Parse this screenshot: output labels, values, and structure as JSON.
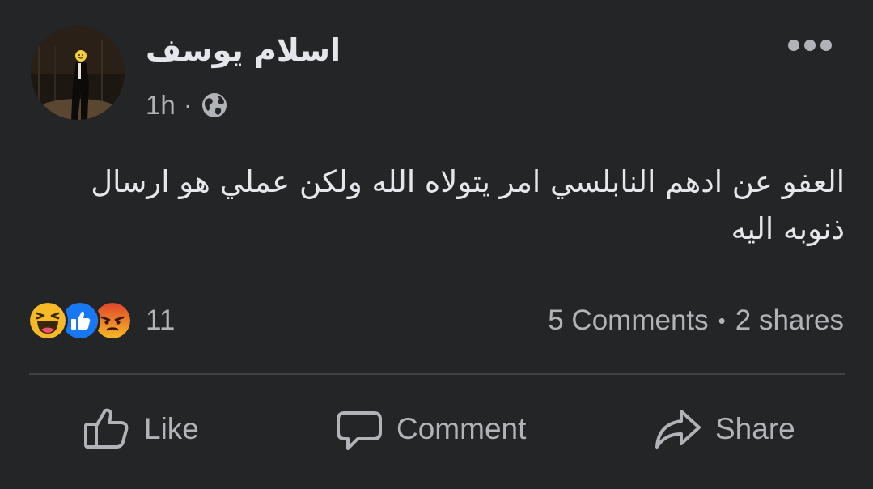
{
  "post": {
    "author": "اسلام يوسف",
    "time": "1h",
    "separator": "·",
    "audience_icon": "globe-icon",
    "more_icon": "more-dots-icon",
    "text": "العفو عن ادهم النابلسي امر يتولاه الله ولكن عملي هو ارسال ذنوبه اليه"
  },
  "reactions": {
    "icons": [
      "haha-icon",
      "like-icon",
      "angry-icon"
    ],
    "count": "11"
  },
  "stats": {
    "comments": "5 Comments",
    "separator": "•",
    "shares": "2 shares"
  },
  "actions": {
    "like": "Like",
    "comment": "Comment",
    "share": "Share"
  },
  "colors": {
    "background": "#242526",
    "text_primary": "#e4e6eb",
    "text_secondary": "#b0b3b8",
    "like_blue": "#1877f2",
    "angry_orange": "#f3692a",
    "haha_yellow": "#f7b928"
  }
}
